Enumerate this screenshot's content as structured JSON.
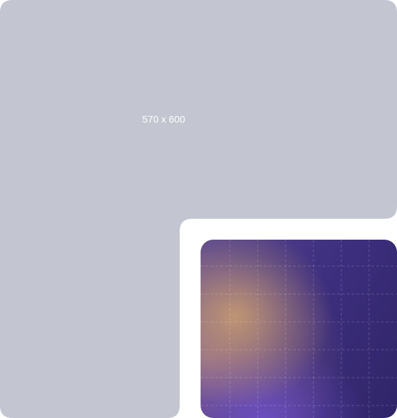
{
  "placeholder": {
    "label": "570 x 600",
    "fill_color": "#c3c5d0"
  },
  "gradient_card": {
    "colors": {
      "warm_glow": "#cda06e",
      "violet_glow": "#6e50c8",
      "base_dark": "#2f2468",
      "grid_line": "#ffffff"
    }
  }
}
